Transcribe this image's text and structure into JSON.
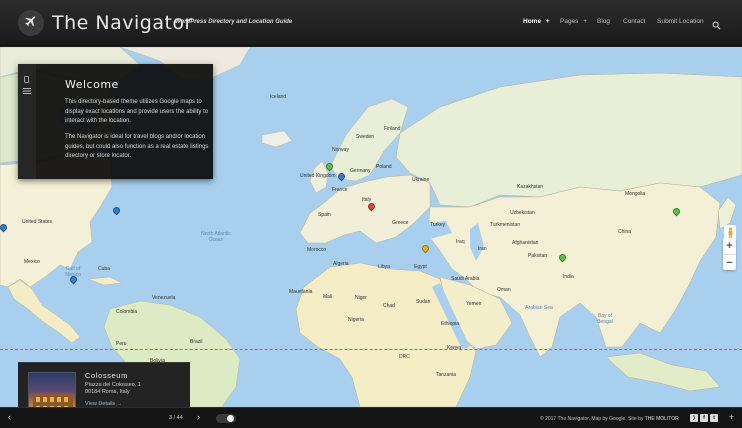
{
  "header": {
    "site_title": "The Navigator",
    "tagline": "WordPress Directory and Location Guide",
    "nav": [
      {
        "label": "Home",
        "suffix": "+"
      },
      {
        "label": "Pages",
        "suffix": "+"
      },
      {
        "label": "Blog",
        "suffix": ""
      },
      {
        "label": "Contact",
        "suffix": ""
      },
      {
        "label": "Submit Location",
        "suffix": ""
      }
    ],
    "search_icon": "search-icon",
    "logo_icon": "airplane-icon"
  },
  "welcome": {
    "title": "Welcome",
    "paragraph_1": "This directory-based theme utilizes Google maps to display exact locations and provide users the ability to interact with the location.",
    "paragraph_2": "The Navigator is ideal for travel blogs and/or location guides, but could also function as a real estate listings directory or store locator.",
    "strip_icons": [
      "mobile-icon",
      "menu-icon"
    ]
  },
  "map": {
    "labels": [
      "Iceland",
      "Sweden",
      "Finland",
      "Norway",
      "United Kingdom",
      "Poland",
      "Germany",
      "Ukraine",
      "France",
      "Italy",
      "Spain",
      "Greece",
      "Turkey",
      "Kazakhstan",
      "Mongolia",
      "China",
      "Iraq",
      "Iran",
      "Afghanistan",
      "Pakistan",
      "India",
      "Turkmenistan",
      "Uzbekistan",
      "Egypt",
      "Libya",
      "Algeria",
      "Morocco",
      "Mauritania",
      "Mali",
      "Niger",
      "Chad",
      "Sudan",
      "Saudi Arabia",
      "Yemen",
      "Oman",
      "Ethiopia",
      "Kenya",
      "DRC",
      "Tanzania",
      "Nigeria",
      "United States",
      "Mexico",
      "Cuba",
      "Venezuela",
      "Colombia",
      "Peru",
      "Brazil",
      "Bolivia"
    ],
    "ocean_labels": [
      "North Atlantic Ocean",
      "Gulf of Mexico",
      "Arabian Sea",
      "Bay of Bengal"
    ],
    "zoom_in": "+",
    "zoom_out": "−",
    "pin_colors": [
      "#5dc14a",
      "#2e7ed6",
      "#d84a3c",
      "#e6b21f"
    ]
  },
  "location_card": {
    "name": "Colosseum",
    "address_line1": "Piazza del Colosseo, 1",
    "address_line2": "00184 Roma, Italy",
    "link": "View Details →"
  },
  "footer": {
    "prev": "‹",
    "next": "›",
    "counter": "3 / 44",
    "copyright": "© 2017 The Navigator. Map by Google. Site by",
    "credit_link": "THE MOLITOR",
    "social_icons": [
      "rss-icon",
      "facebook-icon",
      "twitter-icon"
    ],
    "expand": "+"
  }
}
